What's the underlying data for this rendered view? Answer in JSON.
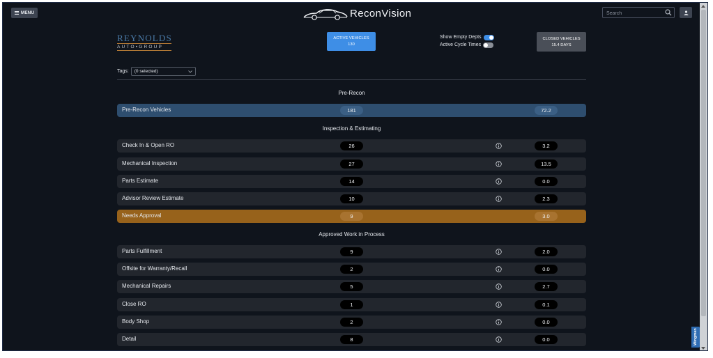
{
  "header": {
    "menu_label": "MENU",
    "brand_name": "ReconVision",
    "search_placeholder": "Search"
  },
  "dealer_logo": {
    "line1": "REYNOLDS",
    "line2": "AUTO•GROUP"
  },
  "active_vehicles": {
    "label": "ACTIVE VEHICLES",
    "value": "130"
  },
  "closed_vehicles": {
    "label": "CLOSED VEHICLES",
    "value": "15.4 DAYS"
  },
  "toggles": [
    {
      "label": "Show Empty Depts",
      "state": "on"
    },
    {
      "label": "Active Cycle Times",
      "state": "off"
    }
  ],
  "tags": {
    "label": "Tags:",
    "value": "(0 selected)"
  },
  "sections": [
    {
      "title": "Pre-Recon"
    },
    {
      "title": "Inspection & Estimating"
    },
    {
      "title": "Approved Work in Process"
    }
  ],
  "rows": [
    {
      "label": "Pre-Recon Vehicles",
      "count": "181",
      "days": "72.2",
      "style": "blue",
      "info": false
    },
    {
      "label": "Check In & Open RO",
      "count": "26",
      "days": "3.2",
      "style": "dark",
      "info": true
    },
    {
      "label": "Mechanical Inspection",
      "count": "27",
      "days": "13.5",
      "style": "dark",
      "info": true
    },
    {
      "label": "Parts Estimate",
      "count": "14",
      "days": "0.0",
      "style": "dark",
      "info": true
    },
    {
      "label": "Advisor Review Estimate",
      "count": "10",
      "days": "2.3",
      "style": "dark",
      "info": true
    },
    {
      "label": "Needs Approval",
      "count": "9",
      "days": "3.0",
      "style": "orange",
      "info": false
    },
    {
      "label": "Parts Fulfillment",
      "count": "9",
      "days": "2.0",
      "style": "dark",
      "info": true
    },
    {
      "label": "Offsite for Warranty/Recall",
      "count": "2",
      "days": "0.0",
      "style": "dark",
      "info": true
    },
    {
      "label": "Mechanical Repairs",
      "count": "5",
      "days": "2.7",
      "style": "dark",
      "info": true
    },
    {
      "label": "Close RO",
      "count": "1",
      "days": "0.1",
      "style": "dark",
      "info": true
    },
    {
      "label": "Body Shop",
      "count": "2",
      "days": "0.0",
      "style": "dark",
      "info": true
    },
    {
      "label": "Detail",
      "count": "8",
      "days": "0.0",
      "style": "dark",
      "info": true
    }
  ],
  "wingman_label": "Wingman",
  "colors": {
    "background": "#0f141c",
    "accent": "#3e8ee6",
    "highlight_blue": "#2e4e6f",
    "highlight_orange": "#97621b"
  }
}
